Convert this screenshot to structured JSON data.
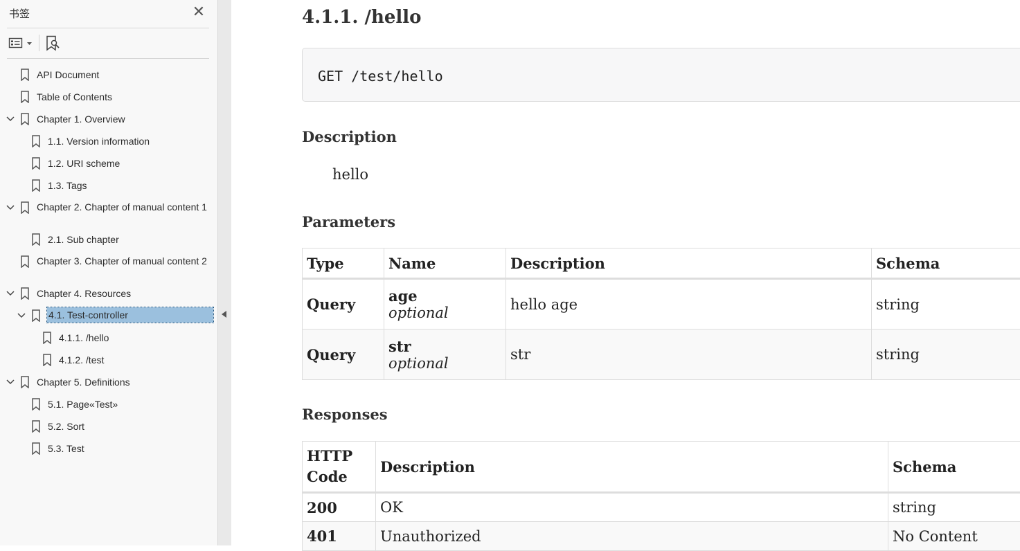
{
  "sidebar": {
    "title": "书签",
    "close_icon": "close-icon",
    "toolbar": {
      "options_icon": "list-options-icon",
      "bookmark_icon": "find-bookmark-icon"
    },
    "items": [
      {
        "label": "API Document"
      },
      {
        "label": "Table of Contents"
      },
      {
        "label": "Chapter 1. Overview"
      },
      {
        "label": "1.1. Version information"
      },
      {
        "label": "1.2. URI scheme"
      },
      {
        "label": "1.3. Tags"
      },
      {
        "label": "Chapter 2. Chapter of manual content 1"
      },
      {
        "label": "2.1. Sub chapter"
      },
      {
        "label": "Chapter 3. Chapter of manual content 2"
      },
      {
        "label": "Chapter 4. Resources"
      },
      {
        "label": "4.1. Test-controller"
      },
      {
        "label": "4.1.1. /hello"
      },
      {
        "label": "4.1.2. /test"
      },
      {
        "label": "Chapter 5. Definitions"
      },
      {
        "label": "5.1. Page«Test»"
      },
      {
        "label": "5.2. Sort"
      },
      {
        "label": "5.3. Test"
      }
    ],
    "selected_index": 10
  },
  "doc": {
    "heading": "4.1.1. /hello",
    "request": "GET /test/hello",
    "description_title": "Description",
    "description_text": "hello",
    "parameters_title": "Parameters",
    "parameters": {
      "headers": [
        "Type",
        "Name",
        "Description",
        "Schema"
      ],
      "rows": [
        {
          "type": "Query",
          "name": "age",
          "flag": "optional",
          "description": "hello age",
          "schema": "string"
        },
        {
          "type": "Query",
          "name": "str",
          "flag": "optional",
          "description": "str",
          "schema": "string"
        }
      ]
    },
    "responses_title": "Responses",
    "responses": {
      "headers": [
        "HTTP Code",
        "Description",
        "Schema"
      ],
      "rows": [
        {
          "code": "200",
          "description": "OK",
          "schema": "string"
        },
        {
          "code": "401",
          "description": "Unauthorized",
          "schema": "No Content"
        }
      ]
    }
  }
}
